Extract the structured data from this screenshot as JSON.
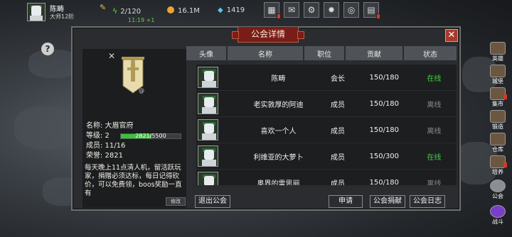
{
  "player": {
    "name": "陈畴",
    "title": "大师12阶"
  },
  "resources": {
    "energy": "2/120",
    "energy_timer": "11:19 +1",
    "gold": "16.1M",
    "gems": "1419"
  },
  "top_icons": [
    "shop-icon",
    "mail-icon",
    "settings-pipe-icon",
    "gear-icon",
    "palette-icon",
    "quest-icon"
  ],
  "help_label": "?",
  "modal": {
    "title": "公会详情",
    "close_label": "✕"
  },
  "guild": {
    "name_label": "名称: 大眉官府",
    "level_label": "等级: 2",
    "level_progress": "2821/5500",
    "level_fraction": 0.513,
    "members_label": "成员: 11/16",
    "honor_label": "荣誉: 2821",
    "notice": "每天晚上11点清人机，留活跃玩家，捐赠必须达标，每日记得砍价，可以免费领，boos奖励一直有",
    "edit_label": "修改",
    "badge": "@",
    "x_mark": "✕"
  },
  "table": {
    "headers": [
      "头像",
      "名称",
      "职位",
      "贡献",
      "状态"
    ],
    "rows": [
      {
        "name": "陈畴",
        "position": "会长",
        "contribution": "150/180",
        "status": "在线"
      },
      {
        "name": "老实敦厚的阿迪",
        "position": "成员",
        "contribution": "150/180",
        "status": "离线"
      },
      {
        "name": "喜欢一个人",
        "position": "成员",
        "contribution": "150/180",
        "status": "离线"
      },
      {
        "name": "利维亚的大萝卜",
        "position": "成员",
        "contribution": "150/300",
        "status": "在线"
      },
      {
        "name": "奥界的雷思丽",
        "position": "成员",
        "contribution": "150/180",
        "status": "离线"
      }
    ]
  },
  "buttons": {
    "leave": "退出公会",
    "apply": "申请",
    "donate": "公会捐献",
    "log": "公会日志"
  },
  "sidebar": [
    {
      "label": "英雄",
      "icon": "hero-icon"
    },
    {
      "label": "城堡",
      "icon": "castle-icon"
    },
    {
      "label": "集市",
      "icon": "market-icon"
    },
    {
      "label": "锻造",
      "icon": "forge-icon"
    },
    {
      "label": "仓库",
      "icon": "warehouse-icon"
    },
    {
      "label": "培养",
      "icon": "train-icon"
    },
    {
      "label": "公会",
      "icon": "guild-icon"
    },
    {
      "label": "战斗",
      "icon": "battle-icon"
    }
  ],
  "colors": {
    "online": "#3fd23f",
    "offline": "#8c8c8c",
    "title_bar": "#7a1c18",
    "progress": "#3fbf3f"
  }
}
